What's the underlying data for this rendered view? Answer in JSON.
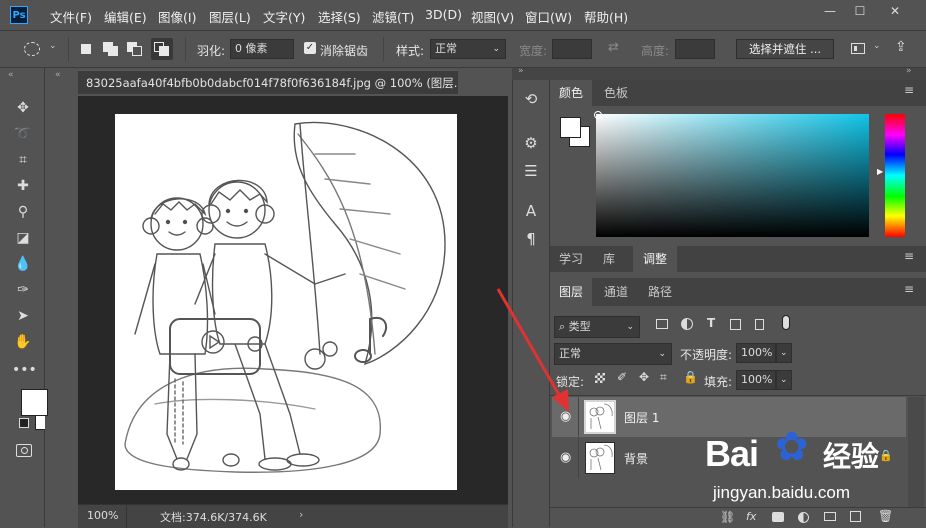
{
  "menu": {
    "logo": "Ps",
    "items": [
      "文件(F)",
      "编辑(E)",
      "图像(I)",
      "图层(L)",
      "文字(Y)",
      "选择(S)",
      "滤镜(T)",
      "3D(D)",
      "视图(V)",
      "窗口(W)",
      "帮助(H)"
    ]
  },
  "window": {
    "minimize": "—",
    "maximize": "☐",
    "close": "✕"
  },
  "options": {
    "feather_label": "羽化:",
    "feather_value": "0 像素",
    "antialias_label": "消除锯齿",
    "antialias_checked": true,
    "style_label": "样式:",
    "style_value": "正常",
    "width_label": "宽度:",
    "height_label": "高度:",
    "select_mask_button": "选择并遮住 ..."
  },
  "document": {
    "tab_title": "83025aafa40f4bfb0b0dabcf014f78f0f636184f.jpg @ 100% (图层...",
    "zoom": "100%",
    "doc_info": "文档:374.6K/374.6K",
    "status_arrow": "›"
  },
  "color_panel": {
    "tabs": [
      "颜色",
      "色板"
    ],
    "active_tab": "颜色",
    "hue_color": "#11c4e8"
  },
  "adjust_panel": {
    "tabs": [
      "学习",
      "库",
      "调整"
    ],
    "active_tab": "调整"
  },
  "layers_panel": {
    "tabs": [
      "图层",
      "通道",
      "路径"
    ],
    "active_tab": "图层",
    "filter_kind": "类型",
    "blend_mode": "正常",
    "opacity_label": "不透明度:",
    "opacity_value": "100%",
    "lock_label": "锁定:",
    "fill_label": "填充:",
    "fill_value": "100%",
    "layers": [
      {
        "name": "图层 1",
        "visible": true,
        "selected": true,
        "locked": false
      },
      {
        "name": "背景",
        "visible": true,
        "selected": false,
        "locked": true
      }
    ],
    "footer_fx": "fx"
  },
  "watermark": {
    "brand": "Bai",
    "brand2": "经验",
    "url": "jingyan.baidu.com"
  },
  "colors": {
    "ui_bg": "#535353",
    "dark": "#3c3c3c",
    "pasteboard": "#282828",
    "annotation_arrow": "#e03232",
    "baidu_blue": "#2b63d7"
  }
}
